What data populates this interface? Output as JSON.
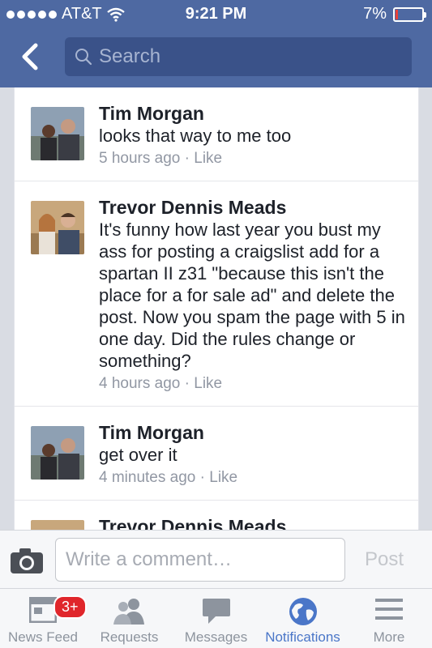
{
  "status": {
    "carrier": "AT&T",
    "time": "9:21 PM",
    "battery": "7%",
    "battery_level": 0.07
  },
  "nav": {
    "search_placeholder": "Search"
  },
  "comments": [
    {
      "author": "Tim Morgan",
      "text": "looks that way to me too",
      "time": "5 hours ago",
      "separator": "·",
      "like": "Like"
    },
    {
      "author": "Trevor Dennis Meads",
      "text": "It's funny how last year you bust my ass for posting a craigslist add for a spartan II z31 \"because this isn't the place for a for sale ad\" and delete the post. Now you spam the page with 5 in one day. Did the rules change or something?",
      "time": "4 hours ago",
      "separator": "·",
      "like": "Like"
    },
    {
      "author": "Tim Morgan",
      "text": "get over it",
      "time": "4 minutes ago",
      "separator": "·",
      "like": "Like"
    },
    {
      "author": "Trevor Dennis Meads"
    }
  ],
  "composer": {
    "placeholder": "Write a comment…",
    "post_label": "Post"
  },
  "tabs": [
    {
      "label": "News Feed",
      "badge": "3+"
    },
    {
      "label": "Requests"
    },
    {
      "label": "Messages"
    },
    {
      "label": "Notifications"
    },
    {
      "label": "More"
    }
  ]
}
